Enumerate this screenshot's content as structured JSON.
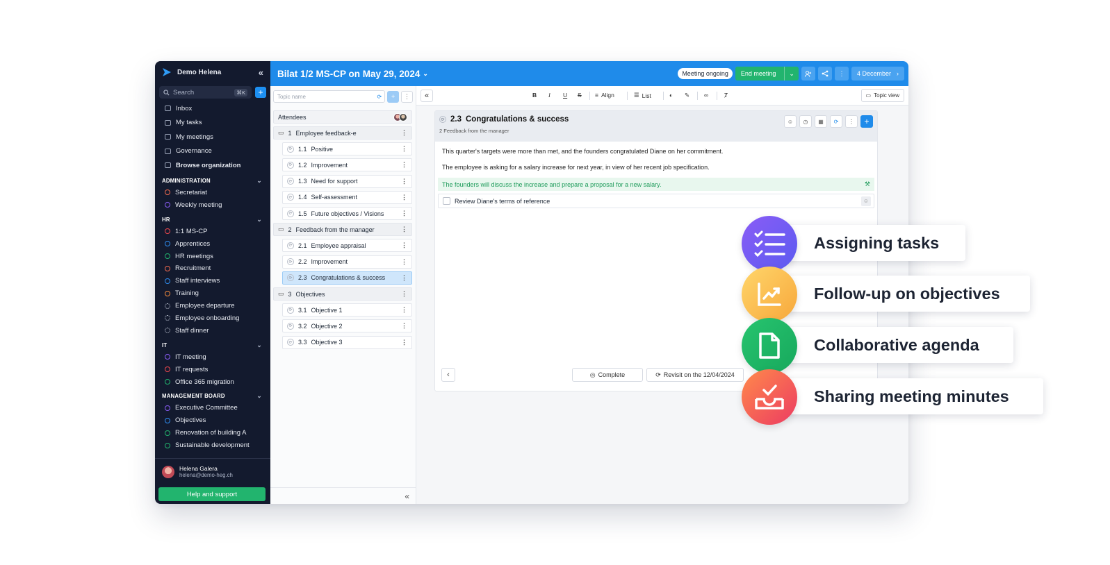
{
  "sidebar": {
    "org": "Demo Helena",
    "search": "Search",
    "shortcut": "⌘K",
    "nav": [
      "Inbox",
      "My tasks",
      "My meetings",
      "Governance",
      "Browse organization"
    ],
    "sections": [
      {
        "title": "ADMINISTRATION",
        "items": [
          "Secretariat",
          "Weekly meeting"
        ]
      },
      {
        "title": "HR",
        "items": [
          "1:1 MS-CP",
          "Apprentices",
          "HR meetings",
          "Recruitment",
          "Staff interviews",
          "Training",
          "Employee departure",
          "Employee onboarding",
          "Staff dinner"
        ]
      },
      {
        "title": "IT",
        "items": [
          "IT meeting",
          "IT requests",
          "Office 365 migration"
        ]
      },
      {
        "title": "MANAGEMENT BOARD",
        "items": [
          "Executive Committee",
          "Objectives",
          "Renovation of building A",
          "Sustainable development"
        ]
      }
    ],
    "user": {
      "name": "Helena Galera",
      "email": "helena@demo-heg.ch"
    },
    "help": "Help and support"
  },
  "topbar": {
    "title": "Bilat 1/2 MS-CP on May 29, 2024",
    "status": "Meeting ongoing",
    "end": "End meeting",
    "date": "4 December"
  },
  "topics": {
    "placeholder": "Topic name",
    "attendees": "Attendees",
    "rows": [
      {
        "n": "1",
        "t": "Employee feedback-e"
      },
      {
        "n": "1.1",
        "t": "Positive"
      },
      {
        "n": "1.2",
        "t": "Improvement"
      },
      {
        "n": "1.3",
        "t": "Need for support"
      },
      {
        "n": "1.4",
        "t": "Self-assessment"
      },
      {
        "n": "1.5",
        "t": "Future objectives / Visions"
      },
      {
        "n": "2",
        "t": "Feedback from the manager"
      },
      {
        "n": "2.1",
        "t": "Employee appraisal"
      },
      {
        "n": "2.2",
        "t": "Improvement"
      },
      {
        "n": "2.3",
        "t": "Congratulations & success"
      },
      {
        "n": "3",
        "t": "Objectives"
      },
      {
        "n": "3.1",
        "t": "Objective 1"
      },
      {
        "n": "3.2",
        "t": "Objective 2"
      },
      {
        "n": "3.3",
        "t": "Objective 3"
      }
    ]
  },
  "toolbar": {
    "align": "Align",
    "list": "List",
    "topic_view": "Topic view"
  },
  "topic": {
    "number": "2.3",
    "title": "Congratulations & success",
    "parent": "2 Feedback from the manager",
    "p1": "This quarter's targets were more than met, and the founders congratulated Diane on her commitment.",
    "p2": "The employee is asking for a salary increase for next year, in view of her recent job specification.",
    "decision": "The founders will discuss the increase and prepare a proposal for a new salary.",
    "task": "Review Diane's terms of reference",
    "complete": "Complete",
    "revisit": "Revisit on the 12/04/2024"
  },
  "features": [
    "Assigning tasks",
    "Follow-up on objectives",
    "Collaborative agenda",
    "Sharing meeting minutes"
  ],
  "colors": {
    "sidebar": "#131a2e",
    "topbar": "#1f8bea",
    "green": "#22b46e"
  }
}
